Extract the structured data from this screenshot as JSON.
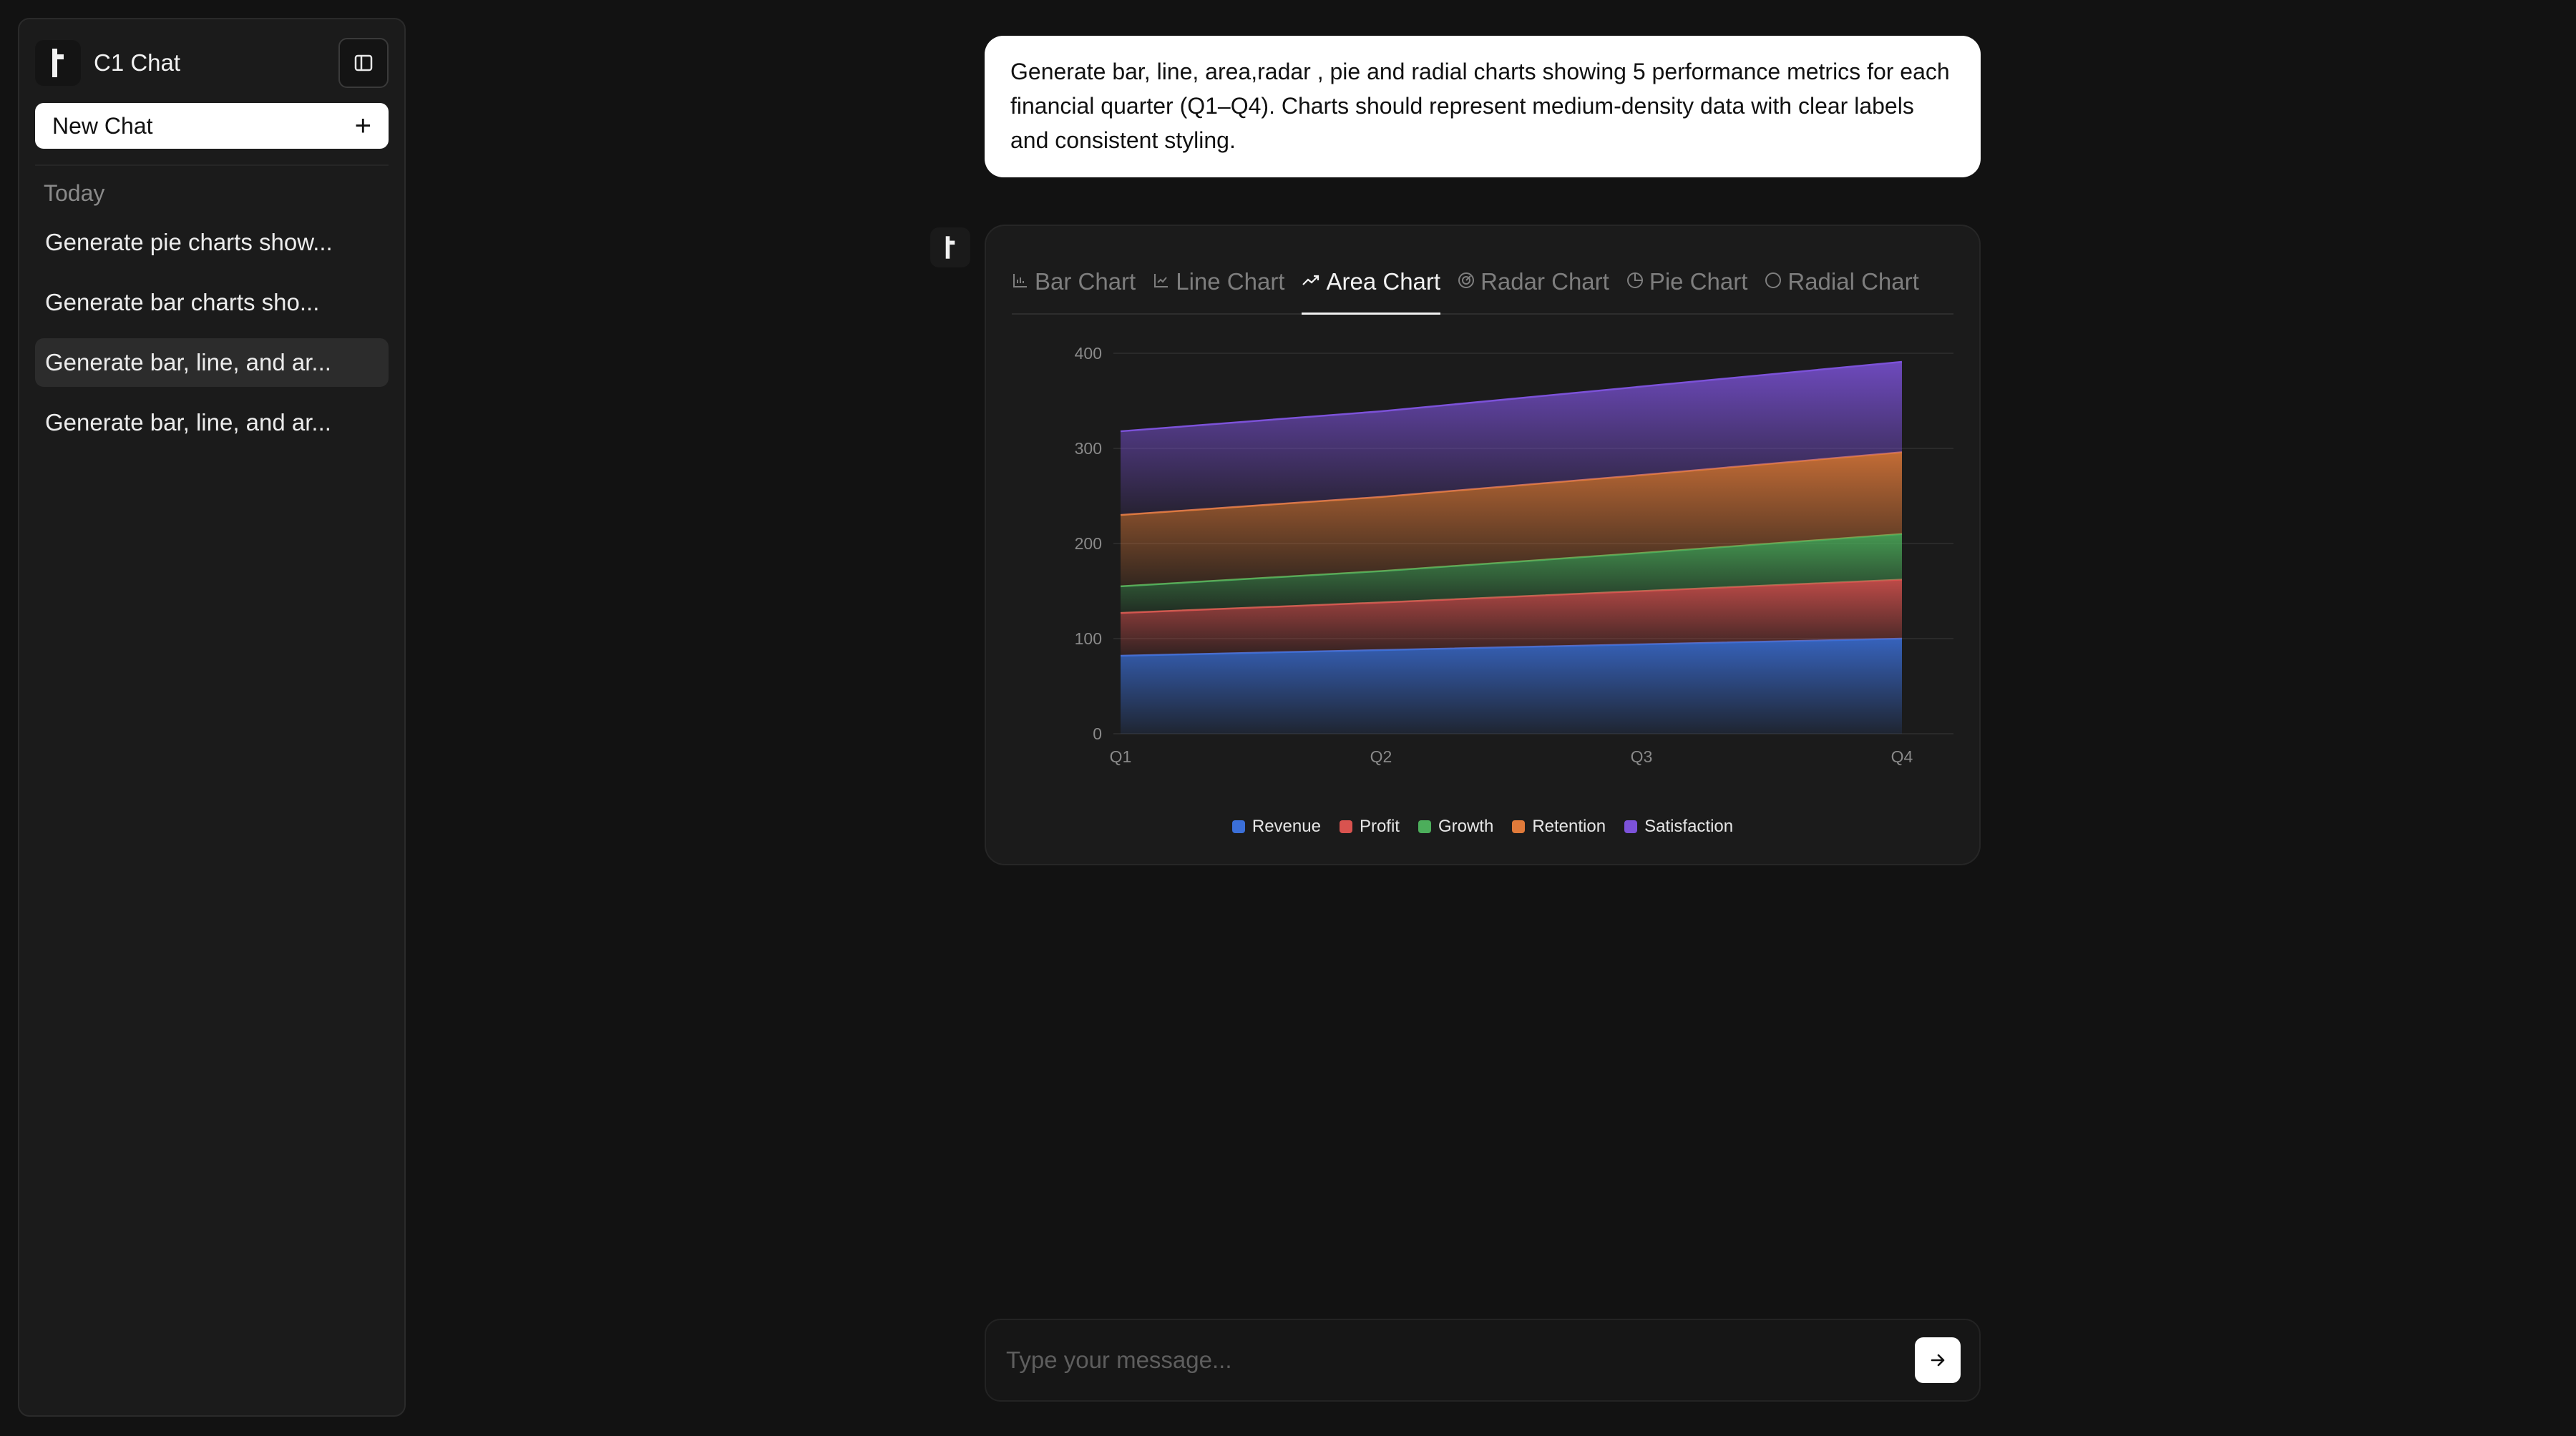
{
  "sidebar": {
    "app_name": "C1 Chat",
    "new_chat_label": "New Chat",
    "section_label": "Today",
    "items": [
      {
        "label": "Generate pie charts show..."
      },
      {
        "label": "Generate bar charts sho..."
      },
      {
        "label": "Generate bar, line, and ar..."
      },
      {
        "label": "Generate bar, line, and ar..."
      }
    ]
  },
  "conversation": {
    "user_message": "Generate bar, line, area,radar , pie and radial charts showing 5 performance metrics for each financial quarter (Q1–Q4). Charts should represent medium-density data with clear labels and consistent styling."
  },
  "tabs": [
    {
      "label": "Bar Chart",
      "icon": "bar-chart-icon"
    },
    {
      "label": "Line Chart",
      "icon": "line-chart-icon"
    },
    {
      "label": "Area Chart",
      "icon": "area-chart-icon"
    },
    {
      "label": "Radar Chart",
      "icon": "radar-chart-icon"
    },
    {
      "label": "Pie Chart",
      "icon": "pie-chart-icon"
    },
    {
      "label": "Radial Chart",
      "icon": "radial-chart-icon"
    }
  ],
  "active_tab": "Area Chart",
  "chart_data": {
    "type": "area",
    "stacked": true,
    "categories": [
      "Q1",
      "Q2",
      "Q3",
      "Q4"
    ],
    "ylim": [
      0,
      400
    ],
    "yticks": [
      0,
      100,
      200,
      300,
      400
    ],
    "grid": true,
    "legend_position": "bottom",
    "series": [
      {
        "name": "Revenue",
        "color": "#3b6fd8",
        "values": [
          82,
          88,
          94,
          100
        ]
      },
      {
        "name": "Profit",
        "color": "#d9534f",
        "values": [
          45,
          50,
          56,
          62
        ]
      },
      {
        "name": "Growth",
        "color": "#4cae5b",
        "values": [
          28,
          33,
          40,
          48
        ]
      },
      {
        "name": "Retention",
        "color": "#e07a3a",
        "values": [
          75,
          78,
          82,
          86
        ]
      },
      {
        "name": "Satisfaction",
        "color": "#7c52d9",
        "values": [
          88,
          90,
          93,
          95
        ]
      }
    ]
  },
  "composer": {
    "placeholder": "Type your message..."
  },
  "icons": {
    "collapse": "sidebar-toggle-icon",
    "add": "plus-icon",
    "send": "arrow-right-icon",
    "logo": "c1-logo-icon"
  }
}
